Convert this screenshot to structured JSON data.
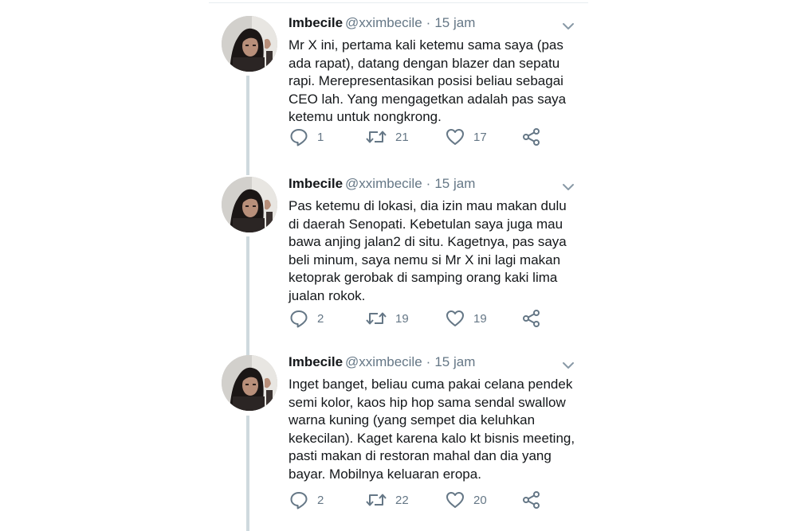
{
  "colors": {
    "name": "#14171a",
    "meta": "#657786",
    "thread_line": "#cfd9de",
    "icon": "#657786"
  },
  "icons": {
    "reply": "reply-icon",
    "retweet": "retweet-icon",
    "like": "heart-icon",
    "share": "share-icon",
    "caret": "chevron-down-icon"
  },
  "tweets": [
    {
      "name": "Imbecile",
      "handle": "@xximbecile",
      "separator": "·",
      "time": "15 jam",
      "text": "Mr X ini, pertama kali ketemu sama saya (pas ada rapat), datang dengan blazer dan sepatu rapi. Merepresentasikan posisi beliau sebagai CEO lah. Yang mengagetkan adalah pas saya ketemu untuk nongkrong.",
      "replies": "1",
      "retweets": "21",
      "likes": "17"
    },
    {
      "name": "Imbecile",
      "handle": "@xximbecile",
      "separator": "·",
      "time": "15 jam",
      "text": "Pas ketemu di lokasi, dia izin mau makan dulu di daerah Senopati. Kebetulan saya juga mau bawa anjing jalan2 di situ. Kagetnya, pas saya beli minum, saya nemu si Mr X ini lagi makan ketoprak gerobak di samping orang kaki lima jualan rokok.",
      "replies": "2",
      "retweets": "19",
      "likes": "19"
    },
    {
      "name": "Imbecile",
      "handle": "@xximbecile",
      "separator": "·",
      "time": "15 jam",
      "text": "Inget banget, beliau cuma pakai celana pendek semi kolor, kaos hip hop sama sendal swallow warna kuning (yang sempet dia keluhkan kekecilan). Kaget karena kalo kt bisnis meeting, pasti makan di restoran mahal dan dia yang bayar. Mobilnya keluaran eropa.",
      "replies": "2",
      "retweets": "22",
      "likes": "20"
    }
  ]
}
